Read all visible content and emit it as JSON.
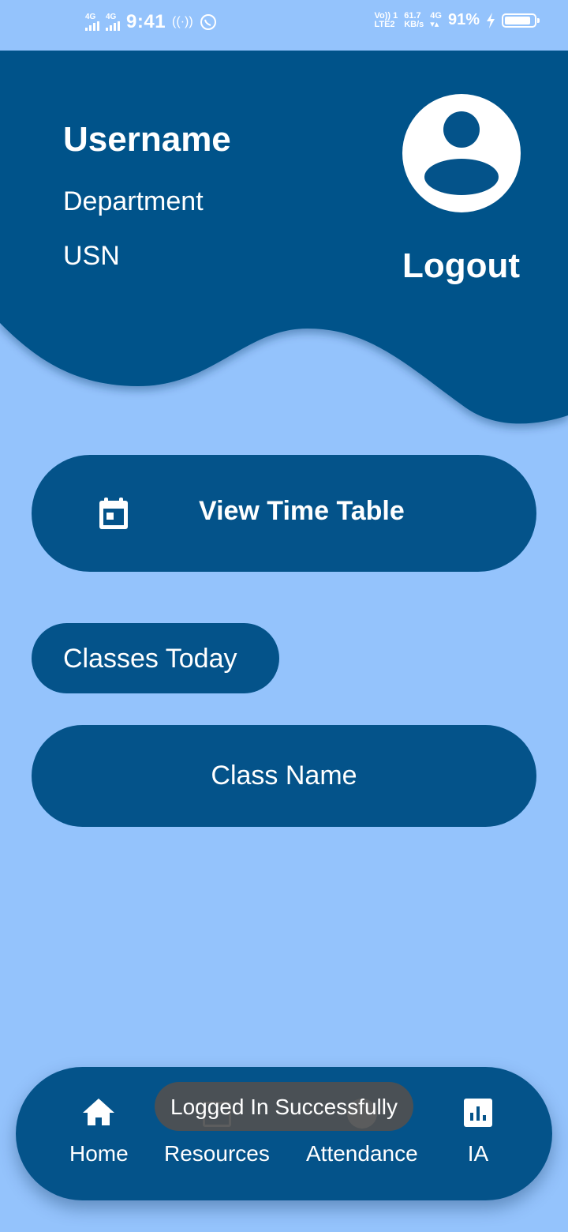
{
  "status_bar": {
    "sim1_network": "4G",
    "sim2_network": "4G",
    "time": "9:41",
    "volte_line1": "Vo)) 1",
    "volte_line2": "LTE2",
    "speed_value": "61.7",
    "speed_unit": "KB/s",
    "data_network": "4G",
    "battery_percent": "91%",
    "icons": [
      "signal-icon",
      "signal-icon",
      "hotspot-icon",
      "whatsapp-icon",
      "charging-icon",
      "battery-icon"
    ]
  },
  "profile": {
    "username": "Username",
    "department": "Department",
    "usn": "USN",
    "avatar_icon": "account-circle-icon",
    "logout_label": "Logout"
  },
  "actions": {
    "timetable_icon": "calendar-icon",
    "timetable_label": "View Time Table",
    "classes_today_label": "Classes Today",
    "class_name_label": "Class Name"
  },
  "bottom_nav": {
    "items": [
      {
        "label": "Home",
        "icon": "home-icon"
      },
      {
        "label": "Resources",
        "icon": "resources-icon"
      },
      {
        "label": "Attendance",
        "icon": "attendance-icon"
      },
      {
        "label": "IA",
        "icon": "bar-chart-icon"
      }
    ]
  },
  "toast": {
    "message": "Logged In Successfully"
  },
  "colors": {
    "background": "#94c3fc",
    "primary": "#04538a",
    "text": "#ffffff",
    "toast_bg": "#505050"
  }
}
